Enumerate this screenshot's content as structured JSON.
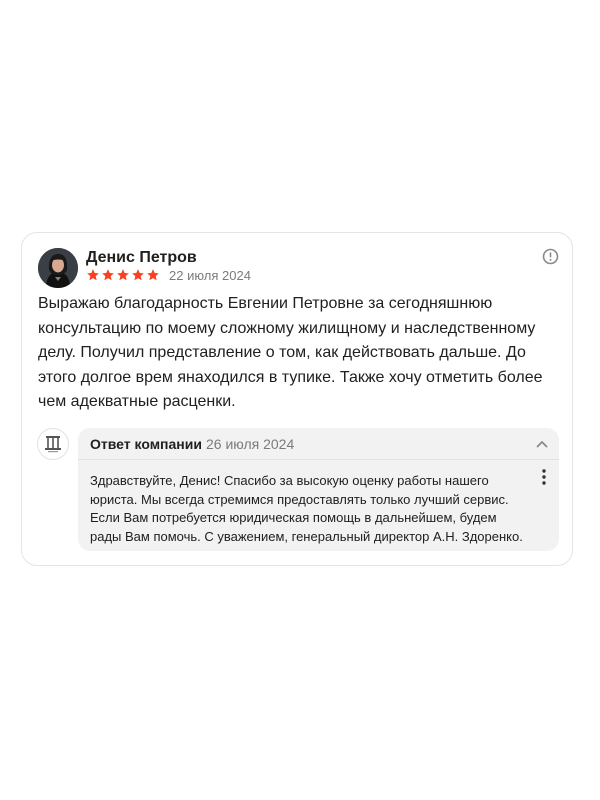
{
  "review": {
    "author_name": "Денис Петров",
    "rating": 5,
    "rating_max": 5,
    "date": "22 июля 2024",
    "text": "Выражаю благодарность Евгении Петровне за сегодняшнюю консультацию по моему сложному жилищному и наследственному делу. Получил представление о том, как действовать дальше. До этого долгое врем янаходился в тупике. Также хочу отметить более чем адекватные расценки."
  },
  "company_reply": {
    "title": "Ответ компании",
    "date": "26 июля 2024",
    "text": "Здравствуйте, Денис! Спасибо за высокую оценку работы нашего юриста. Мы всегда стремимся предоставлять только лучший сервис. Если Вам потребуется юридическая помощь в дальнейшем, будем рады Вам помочь. С уважением, генеральный директор А.Н. Здоренко."
  },
  "icons": {
    "info": "info-icon",
    "star": "star-icon",
    "chevron": "chevron-up-icon",
    "more": "more-vertical-icon"
  },
  "colors": {
    "star": "#fc3f1d",
    "text": "#21201f",
    "muted": "#7b7b7b",
    "reply_bg": "#f2f2f2",
    "card_border": "#e4e4e4"
  }
}
